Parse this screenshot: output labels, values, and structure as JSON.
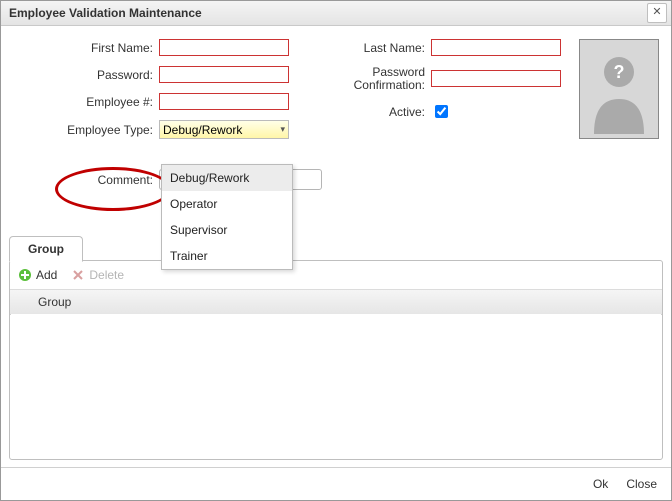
{
  "window": {
    "title": "Employee Validation Maintenance"
  },
  "form": {
    "firstName": {
      "label": "First Name:",
      "value": ""
    },
    "lastName": {
      "label": "Last Name:",
      "value": ""
    },
    "password": {
      "label": "Password:",
      "value": ""
    },
    "passwordConfirm": {
      "label_line1": "Password",
      "label_line2": "Confirmation:",
      "value": ""
    },
    "employeeNo": {
      "label": "Employee #:",
      "value": ""
    },
    "active": {
      "label": "Active:",
      "checked": true
    },
    "employeeType": {
      "label": "Employee Type:",
      "selected": "Debug/Rework",
      "options": [
        "Debug/Rework",
        "Operator",
        "Supervisor",
        "Trainer"
      ]
    },
    "comment": {
      "label": "Comment:",
      "value": ""
    }
  },
  "groupPanel": {
    "tabLabel": "Group",
    "toolbar": {
      "add": "Add",
      "delete": "Delete"
    },
    "columns": [
      "Group"
    ],
    "rows": []
  },
  "buttons": {
    "ok": "Ok",
    "close": "Close"
  }
}
